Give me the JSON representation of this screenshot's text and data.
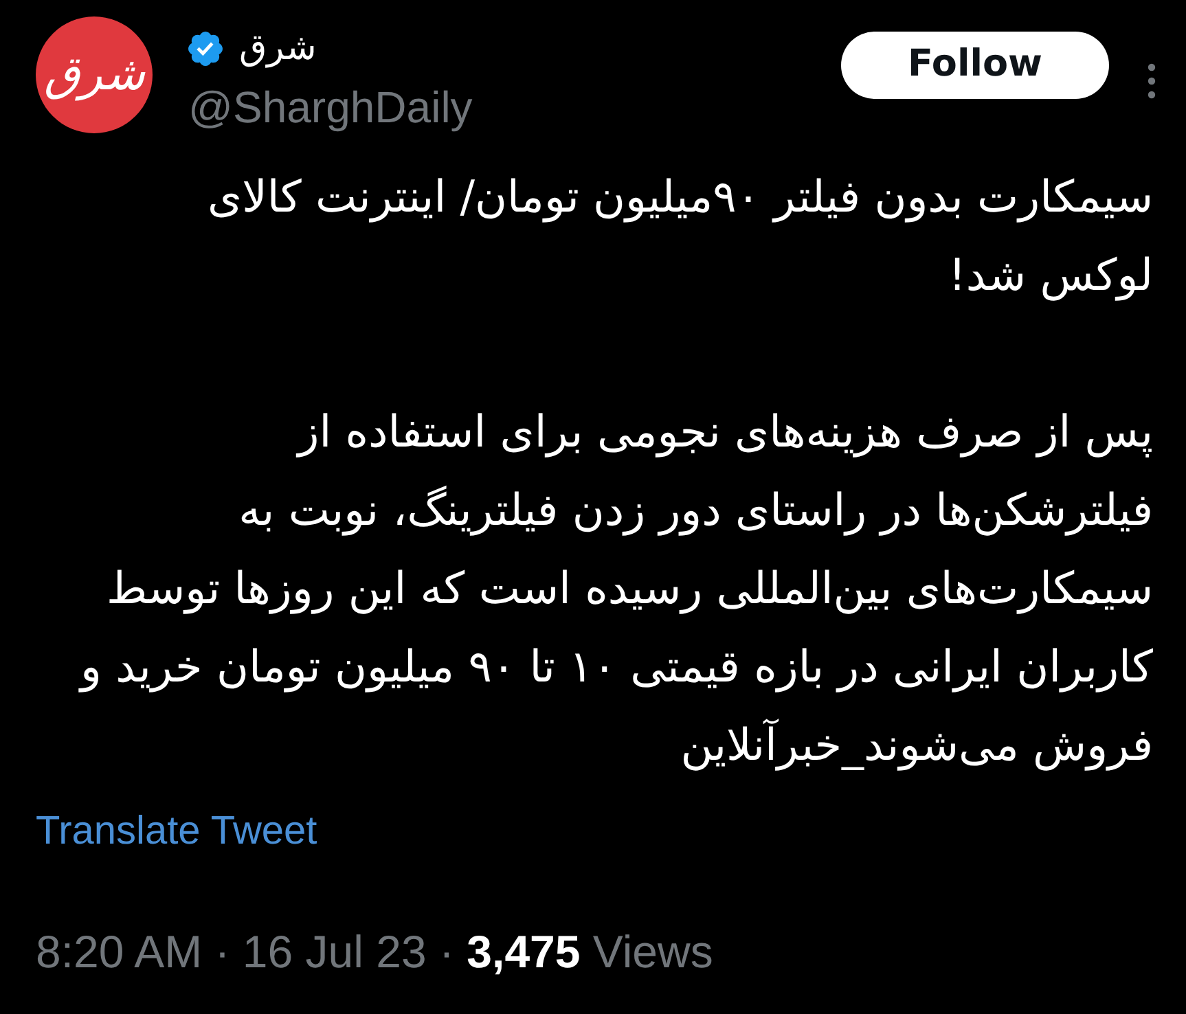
{
  "author": {
    "avatar_logo": "شرق",
    "name": "شرق",
    "verified": true,
    "handle": "@SharghDaily"
  },
  "follow_button": {
    "label": "Follow"
  },
  "tweet": {
    "paragraphs": [
      {
        "lines": [
          "سیمکارت بدون فیلتر ۹۰میلیون تومان/ اینترنت کالای",
          "لوکس شد!"
        ]
      },
      {
        "lines": [
          "پس از صرف هزینه‌های نجومی برای استفاده از",
          "فیلترشکن‌ها در راستای دور زدن فیلترینگ، نوبت به",
          "سیمکارت‌های بین‌المللی رسیده است که این روزها توسط",
          "کاربران ایرانی در بازه قیمتی ۱۰ تا ۹۰ میلیون تومان خرید و",
          "فروش می‌شوند_خبرآنلاین"
        ]
      }
    ]
  },
  "translate_link": "Translate Tweet",
  "meta": "8:20 AM · 16 Jul 23 · **3,475** Views"
}
